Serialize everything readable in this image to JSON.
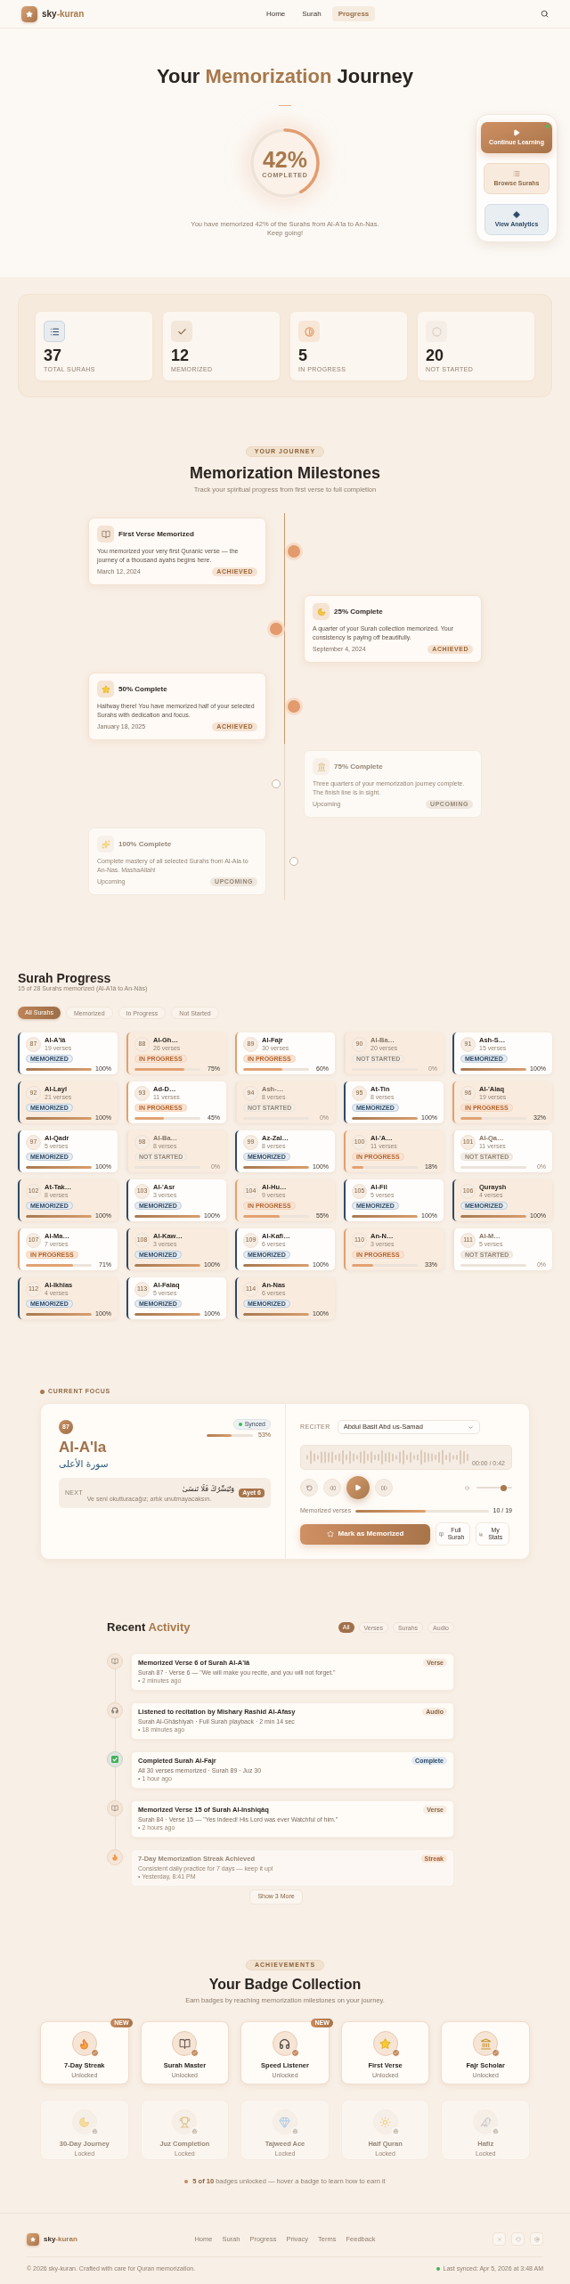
{
  "header": {
    "logo": [
      {
        "text": "sky",
        "accent": false
      },
      {
        "text": "-kuran",
        "accent": true
      }
    ],
    "nav": [
      {
        "label": "Home",
        "selected": false
      },
      {
        "label": "Surah",
        "selected": false
      },
      {
        "label": "Progress",
        "selected": true
      }
    ]
  },
  "hero": {
    "title": [
      {
        "text": "Your",
        "accent": false
      },
      {
        "text": "Memorization",
        "accent": true
      },
      {
        "text": "Journey",
        "accent": false
      }
    ],
    "progress": {
      "value": "42%",
      "label": "COMPLETED",
      "level": 0.42
    },
    "description": "You have memorized 42% of the Surahs from Al-A'la to An-Nas. Keep going!"
  },
  "quick_actions": [
    {
      "label": "Continue Learning",
      "kind": "primary",
      "alert": true
    },
    {
      "label": "Browse Surahs",
      "kind": "browse",
      "alert": false
    },
    {
      "label": "View Analytics",
      "kind": "analytics",
      "alert": false
    }
  ],
  "stats": [
    {
      "value": "37",
      "label": "TOTAL SURAHS"
    },
    {
      "value": "12",
      "label": "MEMORIZED"
    },
    {
      "value": "5",
      "label": "IN PROGRESS"
    },
    {
      "value": "20",
      "label": "NOT STARTED"
    }
  ],
  "milestones": {
    "eyebrow": "YOUR JOURNEY",
    "title": "Memorization Milestones",
    "subtitle": "Track your spiritual progress from first verse to full completion",
    "items": [
      {
        "title": "First Verse Memorized",
        "description": "You memorized your very first Quranic verse — the journey of a thousand ayahs begins here.",
        "date": "March 12, 2024",
        "badge": "ACHIEVED",
        "achieved": true
      },
      {
        "title": "25% Complete",
        "description": "A quarter of your Surah collection memorized. Your consistency is paying off beautifully.",
        "date": "September 4, 2024",
        "badge": "ACHIEVED",
        "achieved": true
      },
      {
        "title": "50% Complete",
        "description": "Halfway there! You have memorized half of your selected Surahs with dedication and focus.",
        "date": "January 18, 2025",
        "badge": "ACHIEVED",
        "achieved": true
      },
      {
        "title": "75% Complete",
        "description": "Three quarters of your memorization journey complete. The finish line is in sight.",
        "date": "Upcoming",
        "badge": "UPCOMING",
        "achieved": false
      },
      {
        "title": "100% Complete",
        "description": "Complete mastery of all selected Surahs from Al-Ala to An-Nas. MashaAllah!",
        "date": "Upcoming",
        "badge": "UPCOMING",
        "achieved": false
      }
    ]
  },
  "surah_progress": {
    "title": "Surah Progress",
    "subtitle": "15 of 28 Surahs memorized (Al-A'lâ to An-Nâs)",
    "filters": [
      {
        "label": "All Surahs",
        "selected": true
      },
      {
        "label": "Memorized",
        "selected": false
      },
      {
        "label": "In Progress",
        "selected": false
      },
      {
        "label": "Not Started",
        "selected": false
      }
    ],
    "surahs": [
      {
        "number": "87",
        "name": "Al-A'lâ",
        "verses": "19 verses",
        "kind": "memorized",
        "badge": "MEMORIZED",
        "level": 1,
        "percent": "100%"
      },
      {
        "number": "88",
        "name": "Al-Gh…",
        "verses": "26 verses",
        "kind": "in_progress",
        "badge": "IN PROGRESS",
        "level": 0.75,
        "percent": "75%"
      },
      {
        "number": "89",
        "name": "Al-Fajr",
        "verses": "30 verses",
        "kind": "in_progress",
        "badge": "IN PROGRESS",
        "level": 0.6,
        "percent": "60%"
      },
      {
        "number": "90",
        "name": "Al-Ba…",
        "verses": "20 verses",
        "kind": "not_started",
        "badge": "NOT STARTED",
        "percent": "0%"
      },
      {
        "number": "91",
        "name": "Ash-S…",
        "verses": "15 verses",
        "kind": "memorized",
        "badge": "MEMORIZED",
        "level": 1,
        "percent": "100%"
      },
      {
        "number": "92",
        "name": "Al-Layl",
        "verses": "21 verses",
        "kind": "memorized",
        "badge": "MEMORIZED",
        "level": 1,
        "percent": "100%"
      },
      {
        "number": "93",
        "name": "Ad-D…",
        "verses": "11 verses",
        "kind": "in_progress",
        "badge": "IN PROGRESS",
        "level": 0.45,
        "percent": "45%"
      },
      {
        "number": "94",
        "name": "Ash-…",
        "verses": "8 verses",
        "kind": "not_started",
        "badge": "NOT STARTED",
        "percent": "0%"
      },
      {
        "number": "95",
        "name": "At-Tin",
        "verses": "8 verses",
        "kind": "memorized",
        "badge": "MEMORIZED",
        "level": 1,
        "percent": "100%"
      },
      {
        "number": "96",
        "name": "Al-'Alaq",
        "verses": "19 verses",
        "kind": "in_progress",
        "badge": "IN PROGRESS",
        "level": 0.32,
        "percent": "32%"
      },
      {
        "number": "97",
        "name": "Al-Qadr",
        "verses": "5 verses",
        "kind": "memorized",
        "badge": "MEMORIZED",
        "level": 1,
        "percent": "100%"
      },
      {
        "number": "98",
        "name": "Al-Ba…",
        "verses": "8 verses",
        "kind": "not_started",
        "badge": "NOT STARTED",
        "percent": "0%"
      },
      {
        "number": "99",
        "name": "Az-Zal…",
        "verses": "8 verses",
        "kind": "memorized",
        "badge": "MEMORIZED",
        "level": 1,
        "percent": "100%"
      },
      {
        "number": "100",
        "name": "Al-'A…",
        "verses": "11 verses",
        "kind": "in_progress",
        "badge": "IN PROGRESS",
        "level": 0.18,
        "percent": "18%"
      },
      {
        "number": "101",
        "name": "Al-Qa…",
        "verses": "11 verses",
        "kind": "not_started",
        "badge": "NOT STARTED",
        "percent": "0%"
      },
      {
        "number": "102",
        "name": "At-Tak…",
        "verses": "8 verses",
        "kind": "memorized",
        "badge": "MEMORIZED",
        "level": 1,
        "percent": "100%"
      },
      {
        "number": "103",
        "name": "Al-'Asr",
        "verses": "3 verses",
        "kind": "memorized",
        "badge": "MEMORIZED",
        "level": 1,
        "percent": "100%"
      },
      {
        "number": "104",
        "name": "Al-Hu…",
        "verses": "9 verses",
        "kind": "in_progress",
        "badge": "IN PROGRESS",
        "level": 0.55,
        "percent": "55%"
      },
      {
        "number": "105",
        "name": "Al-Fil",
        "verses": "5 verses",
        "kind": "memorized",
        "badge": "MEMORIZED",
        "level": 1,
        "percent": "100%"
      },
      {
        "number": "106",
        "name": "Quraysh",
        "verses": "4 verses",
        "kind": "memorized",
        "badge": "MEMORIZED",
        "level": 1,
        "percent": "100%"
      },
      {
        "number": "107",
        "name": "Al-Ma…",
        "verses": "7 verses",
        "kind": "in_progress",
        "badge": "IN PROGRESS",
        "level": 0.71,
        "percent": "71%"
      },
      {
        "number": "108",
        "name": "Al-Kaw…",
        "verses": "3 verses",
        "kind": "memorized",
        "badge": "MEMORIZED",
        "level": 1,
        "percent": "100%"
      },
      {
        "number": "109",
        "name": "Al-Kafi…",
        "verses": "6 verses",
        "kind": "memorized",
        "badge": "MEMORIZED",
        "level": 1,
        "percent": "100%"
      },
      {
        "number": "110",
        "name": "An-N…",
        "verses": "3 verses",
        "kind": "in_progress",
        "badge": "IN PROGRESS",
        "level": 0.33,
        "percent": "33%"
      },
      {
        "number": "111",
        "name": "Al-M…",
        "verses": "5 verses",
        "kind": "not_started",
        "badge": "NOT STARTED",
        "percent": "0%"
      },
      {
        "number": "112",
        "name": "Al-Ikhlas",
        "verses": "4 verses",
        "kind": "memorized",
        "badge": "MEMORIZED",
        "level": 1,
        "percent": "100%"
      },
      {
        "number": "113",
        "name": "Al-Falaq",
        "verses": "5 verses",
        "kind": "memorized",
        "badge": "MEMORIZED",
        "level": 1,
        "percent": "100%"
      },
      {
        "number": "114",
        "name": "An-Nas",
        "verses": "6 verses",
        "kind": "memorized",
        "badge": "MEMORIZED",
        "level": 1,
        "percent": "100%"
      }
    ]
  },
  "current_focus": {
    "eyebrow": "CURRENT FOCUS",
    "number": "87",
    "synced": true,
    "sync_label": "Synced",
    "progress": {
      "level": 0.53,
      "reading": "53%"
    },
    "name": "Al-A'la",
    "arabic_name": "سورة الأعلى",
    "next": {
      "label": "NEXT",
      "arabic": "وَنُيَسِّرُكَ فَلَا تَنسَىٰ",
      "ayah": "Ayet 6",
      "translation": "Ve seni okutturacağız; artık unutmayacaksın."
    },
    "reciter": {
      "label": "RECITER",
      "value": "Abdul Basit Abd us-Samad"
    },
    "time": "00:00 / 0:42",
    "playing": false,
    "volume": {
      "level": 0.75
    },
    "verses": {
      "label": "Memorized verses",
      "level": 0.53,
      "reading": "10 / 19"
    },
    "actions": [
      {
        "label": "Mark as Memorized",
        "kind": "primary"
      },
      {
        "label": "Full Surah",
        "kind": "surah"
      },
      {
        "label": "My Stats",
        "kind": "stats"
      }
    ]
  },
  "recent_activity": {
    "title": [
      {
        "text": "Recent",
        "accent": false
      },
      {
        "text": "Activity",
        "accent": true
      }
    ],
    "filters": [
      {
        "label": "All",
        "selected": true
      },
      {
        "label": "Verses",
        "selected": false
      },
      {
        "label": "Surahs",
        "selected": false
      },
      {
        "label": "Audio",
        "selected": false
      }
    ],
    "items": [
      {
        "kind": "verse",
        "title": "Memorized Verse 6 of Surah Al-A'lâ",
        "detail": "Surah 87 · Verse 6 — \"We will make you recite, and you will not forget.\"",
        "time": "• 2 minutes ago",
        "tag": "Verse",
        "faded": false
      },
      {
        "kind": "audio",
        "title": "Listened to recitation by Mishary Rashid Al-Afasy",
        "detail": "Surah Al-Ghâshiyah · Full Surah playback · 2 min 14 sec",
        "time": "• 18 minutes ago",
        "tag": "Audio",
        "faded": false
      },
      {
        "kind": "complete",
        "title": "Completed Surah Al-Fajr",
        "detail": "All 30 verses memorized · Surah 89 · Juz 30",
        "time": "• 1 hour ago",
        "tag": "Complete",
        "faded": false
      },
      {
        "kind": "verse",
        "title": "Memorized Verse 15 of Surah Al-Inshiqâq",
        "detail": "Surah 84 · Verse 15 — \"Yes indeed! His Lord was ever Watchful of him.\"",
        "time": "• 2 hours ago",
        "tag": "Verse",
        "faded": false
      },
      {
        "kind": "streak",
        "title": "7-Day Memorization Streak Achieved",
        "detail": "Consistent daily practice for 7 days — keep it up!",
        "time": "• Yesterday, 8:41 PM",
        "tag": "Streak",
        "faded": true
      }
    ],
    "more": "Show 3 More"
  },
  "badges": {
    "eyebrow": "ACHIEVEMENTS",
    "title": "Your Badge Collection",
    "subtitle": "Earn badges by reaching memorization milestones on your journey.",
    "items": [
      {
        "name": "7-Day Streak",
        "status": "Unlocked",
        "unlocked": true,
        "ribbon": "NEW"
      },
      {
        "name": "Surah Master",
        "status": "Unlocked",
        "unlocked": true
      },
      {
        "name": "Speed Listener",
        "status": "Unlocked",
        "unlocked": true,
        "ribbon": "NEW"
      },
      {
        "name": "First Verse",
        "status": "Unlocked",
        "unlocked": true
      },
      {
        "name": "Fajr Scholar",
        "status": "Unlocked",
        "unlocked": true
      },
      {
        "name": "30-Day Journey",
        "status": "Locked",
        "unlocked": false
      },
      {
        "name": "Juz Completion",
        "status": "Locked",
        "unlocked": false
      },
      {
        "name": "Tajweed Ace",
        "status": "Locked",
        "unlocked": false
      },
      {
        "name": "Half Quran",
        "status": "Locked",
        "unlocked": false
      },
      {
        "name": "Hafiz",
        "status": "Locked",
        "unlocked": false
      }
    ],
    "summary": "**5 of 10** badges unlocked — hover a badge to learn how to earn it"
  },
  "footer": {
    "logo": [
      {
        "text": "sky",
        "accent": false
      },
      {
        "text": "-kuran",
        "accent": true
      }
    ],
    "links": [
      "Home",
      "Surah",
      "Progress",
      "Privacy",
      "Terms",
      "Feedback"
    ],
    "copyright": "© 2026 sky-kuran. Crafted with care for Quran memorization.",
    "sync": "Last synced: Apr 5, 2026 at 3:48 AM"
  }
}
